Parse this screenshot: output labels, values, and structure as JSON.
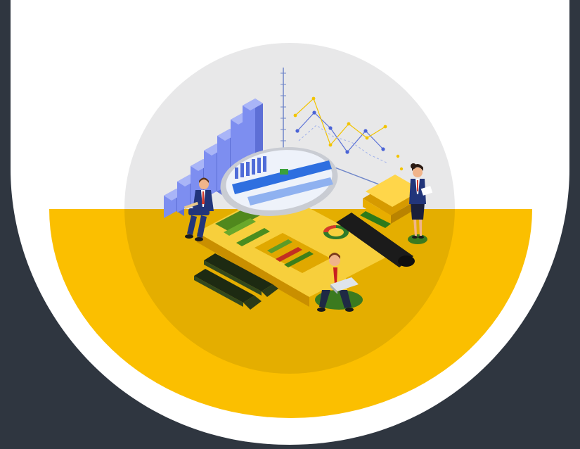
{
  "colors": {
    "page_background": "#2f3640",
    "frame": "#ffffff",
    "halo": "#e8e8e9",
    "accent_yellow": "#fbbf00",
    "bar_blue": "#7d8ef0",
    "navy_suit": "#22357a",
    "ground_green": "#3b7a1f"
  },
  "icons": [
    "bar-chart-icon",
    "line-graph-icon",
    "magnifying-glass-icon",
    "report-document-icon",
    "sticky-notes-icon",
    "marker-icon",
    "businessman-icon",
    "businesswoman-icon",
    "analyst-icon"
  ]
}
